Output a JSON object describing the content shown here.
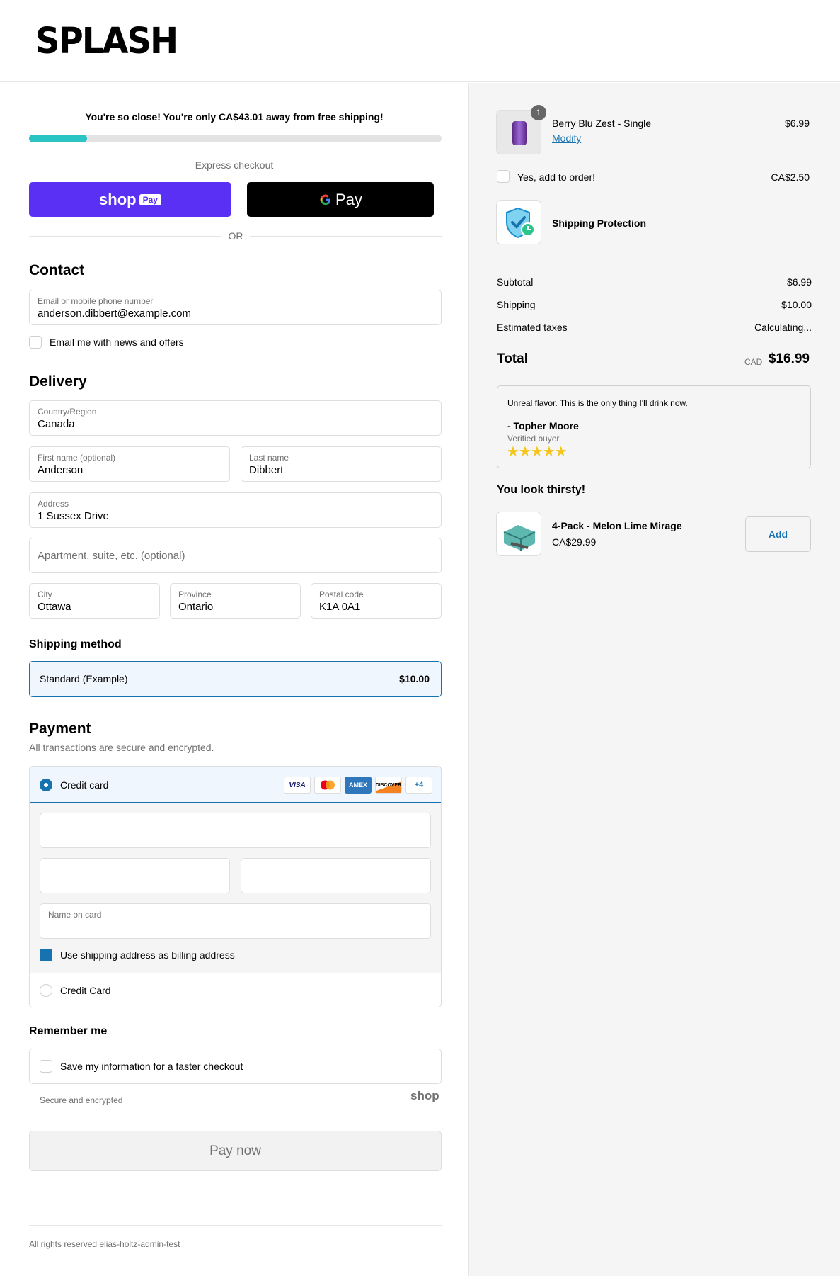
{
  "brand": {
    "logo": "SPLASH"
  },
  "shipping_banner": {
    "text": "You're so close! You're only CA$43.01 away from free shipping!",
    "progress": 0.14
  },
  "express": {
    "label": "Express checkout",
    "shop_pay": "shop",
    "shop_pay_badge": "Pay",
    "gpay": "Pay",
    "or": "OR"
  },
  "contact": {
    "title": "Contact",
    "email_label": "Email or mobile phone number",
    "email_value": "anderson.dibbert@example.com",
    "news_label": "Email me with news and offers"
  },
  "delivery": {
    "title": "Delivery",
    "country_label": "Country/Region",
    "country_value": "Canada",
    "first_label": "First name (optional)",
    "first_value": "Anderson",
    "last_label": "Last name",
    "last_value": "Dibbert",
    "address_label": "Address",
    "address_value": "1 Sussex Drive",
    "apt_placeholder": "Apartment, suite, etc. (optional)",
    "city_label": "City",
    "city_value": "Ottawa",
    "province_label": "Province",
    "province_value": "Ontario",
    "postal_label": "Postal code",
    "postal_value": "K1A 0A1"
  },
  "shipping_method": {
    "title": "Shipping method",
    "name": "Standard (Example)",
    "price": "$10.00"
  },
  "payment": {
    "title": "Payment",
    "subtitle": "All transactions are secure and encrypted.",
    "credit_card": "Credit card",
    "cards": [
      "VISA",
      "MC",
      "AMEX",
      "DISCOVER"
    ],
    "more": "+4",
    "name_on_card": "Name on card",
    "billing_label": "Use shipping address as billing address",
    "alt_method": "Credit Card"
  },
  "remember": {
    "title": "Remember me",
    "save_label": "Save my information for a faster checkout",
    "secure": "Secure and encrypted",
    "shop": "shop"
  },
  "pay_button": "Pay now",
  "footer": "All rights reserved elias-holtz-admin-test",
  "order": {
    "item": {
      "name": "Berry Blu Zest - Single",
      "modify": "Modify",
      "price": "$6.99",
      "qty": "1"
    },
    "addon": {
      "label": "Yes, add to order!",
      "price": "CA$2.50"
    },
    "protection": {
      "label": "Shipping Protection"
    },
    "subtotal_label": "Subtotal",
    "subtotal": "$6.99",
    "shipping_label": "Shipping",
    "shipping": "$10.00",
    "taxes_label": "Estimated taxes",
    "taxes": "Calculating...",
    "total_label": "Total",
    "currency": "CAD",
    "total": "$16.99"
  },
  "review": {
    "quote": "Unreal flavor. This is the only thing I'll drink now.",
    "author": "- Topher Moore",
    "badge": "Verified buyer",
    "stars": 5
  },
  "upsell": {
    "title": "You look thirsty!",
    "name": "4-Pack - Melon Lime Mirage",
    "price": "CA$29.99",
    "add": "Add"
  },
  "colors": {
    "accent": "#1773b0",
    "shop_purple": "#5a31f4",
    "progress": "#2bc4c4",
    "selected_bg": "#f0f6fd"
  }
}
